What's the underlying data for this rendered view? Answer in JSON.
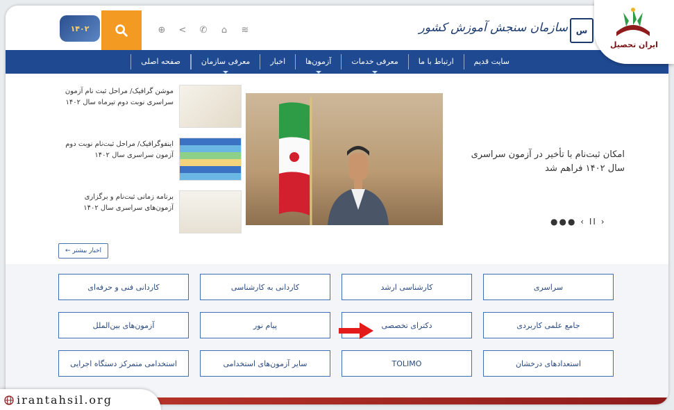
{
  "header": {
    "org_title": "سازمان سنجش آموزش کشور",
    "emblem_label": "س",
    "logo_text": "۱۴۰۲"
  },
  "nav": {
    "items": [
      {
        "label": "صفحه اصلی",
        "has_menu": false
      },
      {
        "label": "معرفی سازمان",
        "has_menu": true
      },
      {
        "label": "اخبار",
        "has_menu": false
      },
      {
        "label": "آزمون‌ها",
        "has_menu": true
      },
      {
        "label": "معرفی خدمات",
        "has_menu": true
      },
      {
        "label": "ارتباط با ما",
        "has_menu": false
      },
      {
        "label": "سایت قدیم",
        "has_menu": false
      }
    ]
  },
  "news": {
    "headline": "امکان ثبت‌نام با تأخیر در آزمون سراسری سال ۱۴۰۲ فراهم شد",
    "slider_controls": "●●● ‹ II ›",
    "side_items": [
      {
        "text": "موشن گرافیک/ مراحل ثبت نام آزمون سراسری نوبت دوم تیرماه سال ۱۴۰۲"
      },
      {
        "text": "اینفوگرافیک/ مراحل ثبت‌نام نوبت دوم آزمون سراسری سال ۱۴۰۲"
      },
      {
        "text": "برنامه زمانی ثبت‌نام و برگزاری آزمون‌های سراسری سال ۱۴۰۲"
      }
    ],
    "more_label": "اخبار بیشتر ←"
  },
  "categories": {
    "row1": [
      "سراسری",
      "کارشناسی ارشد",
      "کاردانی به کارشناسی",
      "کاردانی فنی و حرفه‌ای"
    ],
    "row2": [
      "جامع علمی کاربردی",
      "دکترای تخصصی",
      "پیام نور",
      "آزمون‌های بین‌الملل"
    ],
    "row3": [
      "استعدادهای درخشان",
      "TOLIMO",
      "سایر آزمون‌های استخدامی",
      "استخدامی متمرکز دستگاه اجرایی"
    ]
  },
  "overlay": {
    "brand_name": "ایران تحصیل",
    "url": "irantahsil.org"
  },
  "colors": {
    "nav_bg": "#1f4a92",
    "search_accent": "#f29a21",
    "highlight_arrow": "#e31b1b",
    "footer_bar": "#c0392b"
  }
}
